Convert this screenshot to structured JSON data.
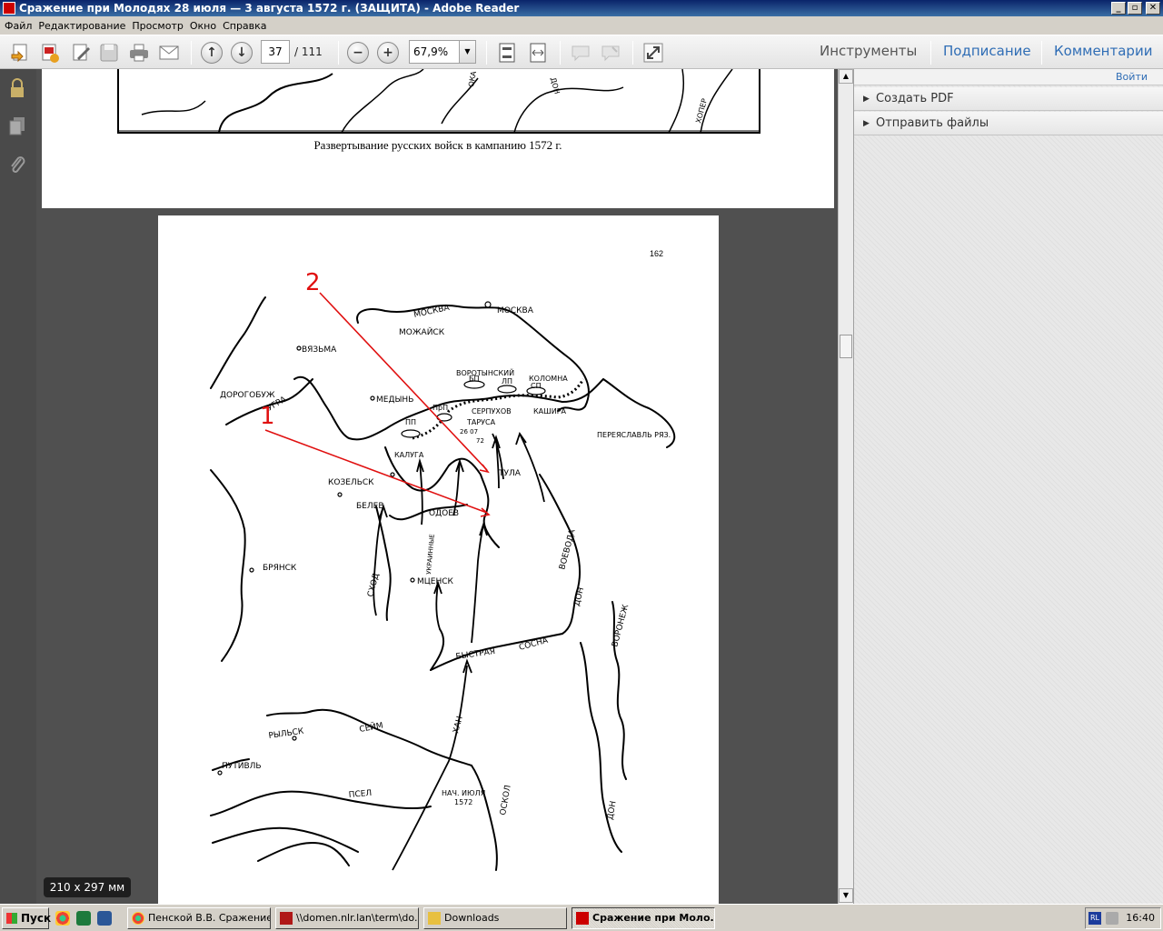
{
  "window": {
    "title": "Сражение при Молодях 28 июля — 3 августа 1572 г. (ЗАЩИТА) - Adobe Reader",
    "minimize": "_",
    "maximize": "▫",
    "close": "✕"
  },
  "menu": [
    "Файл",
    "Редактирование",
    "Просмотр",
    "Окно",
    "Справка"
  ],
  "toolbar": {
    "page_current": "37",
    "page_total": "/ 111",
    "zoom": "67,9%",
    "tabs": [
      "Инструменты",
      "Подписание",
      "Комментарии"
    ]
  },
  "right_panel": {
    "login": "Войти",
    "items": [
      "Создать PDF",
      "Отправить файлы"
    ]
  },
  "document": {
    "caption": "Развертывание русских войск в кампанию 1572 г.",
    "page_number": "162",
    "size_badge": "210 x 297 мм",
    "annotations": [
      "1",
      "2"
    ],
    "map_labels": {
      "moskva_river": "МОСКВА",
      "moskva_city": "МОСКВА",
      "mozhaisk": "МОЖАЙСК",
      "vyazma": "ВЯЗЬМА",
      "dorogobuzh": "ДОРОГОБУЖ",
      "ugra": "УГРА",
      "medyn": "МЕДЫНЬ",
      "vorotynsky": "ВОРОТЫНСКИЙ",
      "bp": "БП",
      "lp": "ЛП",
      "kolomna": "КОЛОМНА",
      "sp": "СП",
      "prp": "ПрП",
      "pp": "ПП",
      "serpukhov": "СЕРПУХОВ",
      "kashira": "КАШИРА",
      "tarusa": "ТАРУСА",
      "date_26_07": "26 07",
      "yr_72": "72",
      "pereyaslavl": "ПЕРЕЯСЛАВЛЬ РЯЗ.",
      "kaluga": "КАЛУГА",
      "tula": "ТУЛА",
      "kozelsk": "КОЗЕЛЬСК",
      "belev": "БЕЛЕВ",
      "odoev": "ОДОЕВ",
      "ukrainnye": "УКРАИННЫЕ",
      "bryansk": "БРЯНСК",
      "skhod": "СХОД",
      "mtsensk": "МЦЕНСК",
      "voevoda": "ВОЕВОДА",
      "don": "ДОН",
      "voronezh": "ВОРОНЕЖ",
      "bystraya": "БЫСТРАЯ",
      "sosna": "СОСНА",
      "khan": "ХАН",
      "rylsk": "РЫЛЬСК",
      "seim": "СЕЙМ",
      "putivl": "ПУТИВЛЬ",
      "psel": "ПСЕЛ",
      "nach_iyulya": "НАЧ. ИЮЛЯ",
      "yr_1572": "1572",
      "oskol": "ОСКОЛ",
      "don_south": "ДОН",
      "top_don": "ДОН",
      "top_oka": "ОКА",
      "top_khoper": "ХОПЕР"
    }
  },
  "taskbar": {
    "start": "Пуск",
    "tasks": [
      "Пенской В.В. Сражение...",
      "\\\\domen.nlr.lan\\term\\do...",
      "Downloads",
      "Сражение при Моло..."
    ],
    "lang": "RL",
    "clock": "16:40"
  },
  "colors": {
    "annotation_red": "#e01010",
    "link_blue": "#2f6db5",
    "titlebar": "#0a246a"
  }
}
